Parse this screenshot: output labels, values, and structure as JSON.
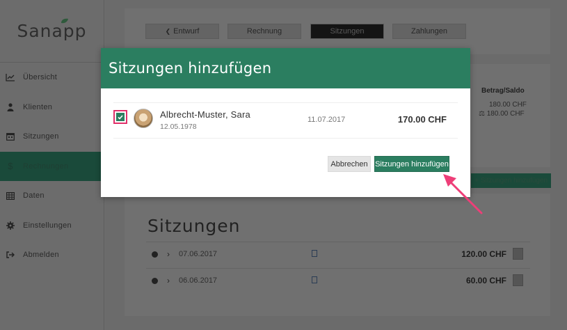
{
  "app": {
    "logo": "Sanapp"
  },
  "sidebar": {
    "items": [
      {
        "label": "Übersicht",
        "icon": "chart-line-icon"
      },
      {
        "label": "Klienten",
        "icon": "user-icon"
      },
      {
        "label": "Sitzungen",
        "icon": "calendar-icon"
      },
      {
        "label": "Rechnungen",
        "icon": "dollar-icon",
        "active": true
      },
      {
        "label": "Daten",
        "icon": "table-icon"
      },
      {
        "label": "Einstellungen",
        "icon": "gear-icon"
      },
      {
        "label": "Abmelden",
        "icon": "sign-out-icon"
      }
    ]
  },
  "tabs": [
    {
      "label": "Entwurf",
      "prefix": "❮"
    },
    {
      "label": "Rechnung"
    },
    {
      "label": "Sitzungen",
      "active": true
    },
    {
      "label": "Zahlungen"
    }
  ],
  "invoice": {
    "balance_header": "Betrag/Saldo",
    "amount": "180.00 CHF",
    "balance": "180.00 CHF",
    "add_sessions_button": "Sitzungen hinzufügen"
  },
  "sessions_section": {
    "title": "Sitzungen",
    "rows": [
      {
        "date": "07.06.2017",
        "amount": "120.00 CHF"
      },
      {
        "date": "06.06.2017",
        "amount": "60.00 CHF"
      }
    ]
  },
  "modal": {
    "title": "Sitzungen hinzufügen",
    "session": {
      "client_name": "Albrecht-Muster, Sara",
      "client_dob": "12.05.1978",
      "date": "11.07.2017",
      "amount": "170.00 CHF",
      "checked": true
    },
    "cancel_label": "Abbrechen",
    "confirm_label": "Sitzungen hinzufügen"
  },
  "colors": {
    "brand_green": "#2b7e60",
    "highlight_pink": "#e0306a"
  }
}
